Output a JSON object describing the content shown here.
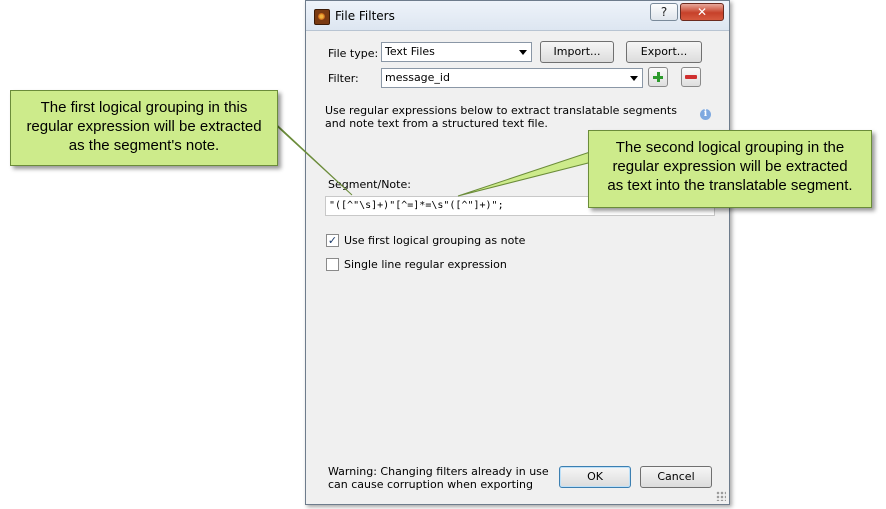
{
  "dialog": {
    "title": "File Filters",
    "help_label": "?",
    "close_label": "✕",
    "file_type_label": "File type:",
    "file_type_value": "Text Files",
    "import_label": "Import...",
    "export_label": "Export...",
    "filter_label": "Filter:",
    "filter_value": "message_id",
    "description": "Use regular expressions below to extract translatable segments and note text from a structured text file.",
    "segment_label": "Segment/Note:",
    "regex_value": "\"([^\"\\s]+)\"[^=]*=\\s\"([^\"]+)\";",
    "checkbox_note_label": "Use first logical grouping as note",
    "checkbox_note_checked": true,
    "checkbox_single_label": "Single line regular expression",
    "checkbox_single_checked": false,
    "warning": "Warning: Changing filters already in use can cause corruption when exporting",
    "ok_label": "OK",
    "cancel_label": "Cancel"
  },
  "callouts": {
    "left": {
      "line1": "The first logical grouping in this",
      "line2": "regular expression will be extracted",
      "line3": "as the segment's note."
    },
    "right": {
      "line1": "The second logical grouping in the",
      "line2": "regular expression will be extracted",
      "line3": "as text into the translatable segment."
    }
  },
  "colors": {
    "callout_fill": "#cdeb8b",
    "add_icon": "#2c9a2c",
    "remove_icon": "#d03030"
  }
}
